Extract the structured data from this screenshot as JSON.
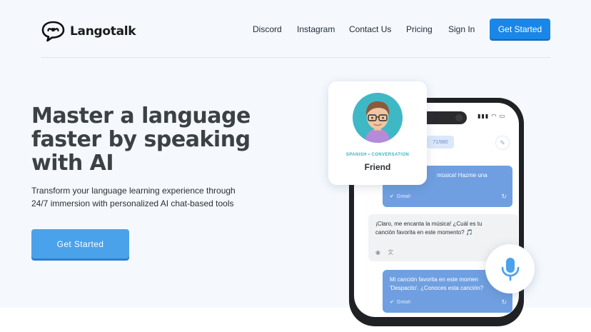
{
  "brand": {
    "name": "Langotalk",
    "logo_icon": "chat-bubble-logo-icon"
  },
  "nav": {
    "links": [
      "Discord",
      "Instagram",
      "Contact Us",
      "Pricing",
      "Sign In"
    ],
    "cta": "Get Started"
  },
  "hero": {
    "headline": "Master a language faster by speaking with AI",
    "subtext": "Transform your language learning experience through 24/7 immersion with personalized AI chat-based tools",
    "cta": "Get Started"
  },
  "friend_card": {
    "tag": "SPANISH • CONVERSATION",
    "name": "Friend"
  },
  "phone": {
    "counter": "71/980",
    "messages": [
      {
        "role": "user",
        "text": "música! Hazme una",
        "meta": "Great!"
      },
      {
        "role": "ai",
        "text": "¡Claro, me encanta la música! ¿Cuál es tu canción favorita en este momento? 🎵"
      },
      {
        "role": "user",
        "text": "Mi canción favorita en este momen 'Despacito'. ¿Conoces esta canción?",
        "meta": "Great!"
      }
    ]
  },
  "colors": {
    "accent": "#1a86e8",
    "hero_button": "#4aa2ea",
    "user_bubble": "#6f9fe0",
    "card_tag": "#38b3c4",
    "avatar_bg": "#3fb8c6",
    "background": "#f5f9fe"
  }
}
